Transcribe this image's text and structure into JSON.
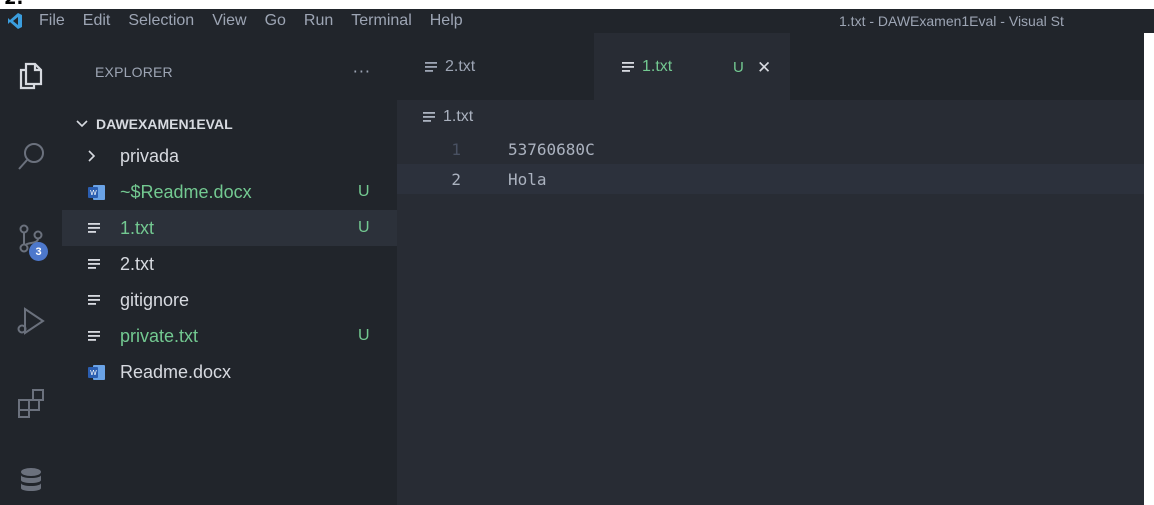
{
  "top_strip": {
    "text": "2."
  },
  "titlebar": {
    "menu": [
      "File",
      "Edit",
      "Selection",
      "View",
      "Go",
      "Run",
      "Terminal",
      "Help"
    ],
    "window_title": "1.txt - DAWExamen1Eval - Visual St"
  },
  "activity_bar": {
    "icons": [
      "explorer-icon",
      "search-icon",
      "source-control-icon",
      "run-debug-icon",
      "extensions-icon",
      "database-icon"
    ],
    "source_control_badge": "3"
  },
  "sidebar": {
    "title": "EXPLORER",
    "more": "···",
    "folder": "DAWEXAMEN1EVAL",
    "items": [
      {
        "label": "privada",
        "icon": "chevron-right-icon",
        "status": "",
        "color": "#d7dae0"
      },
      {
        "label": "~$Readme.docx",
        "icon": "word-file-icon",
        "status": "U",
        "color": "#73c991"
      },
      {
        "label": "1.txt",
        "icon": "text-file-icon",
        "status": "U",
        "color": "#73c991"
      },
      {
        "label": "2.txt",
        "icon": "text-file-icon",
        "status": "",
        "color": "#d7dae0"
      },
      {
        "label": "gitignore",
        "icon": "text-file-icon",
        "status": "",
        "color": "#d7dae0"
      },
      {
        "label": "private.txt",
        "icon": "text-file-icon",
        "status": "U",
        "color": "#73c991"
      },
      {
        "label": "Readme.docx",
        "icon": "word-file-icon",
        "status": "",
        "color": "#d7dae0"
      }
    ],
    "selected_index": 2
  },
  "tabs": [
    {
      "label": "2.txt",
      "status": "",
      "active": false
    },
    {
      "label": "1.txt",
      "status": "U",
      "close": "✕",
      "active": true
    }
  ],
  "editor": {
    "breadcrumb": "1.txt",
    "lines": [
      {
        "number": "1",
        "text": "53760680C"
      },
      {
        "number": "2",
        "text": "Hola"
      }
    ],
    "current_line": 2
  },
  "colors": {
    "untracked": "#73c991",
    "badge": "#4d78cc",
    "editor_bg": "#282c34",
    "sidebar_bg": "#21252b"
  }
}
